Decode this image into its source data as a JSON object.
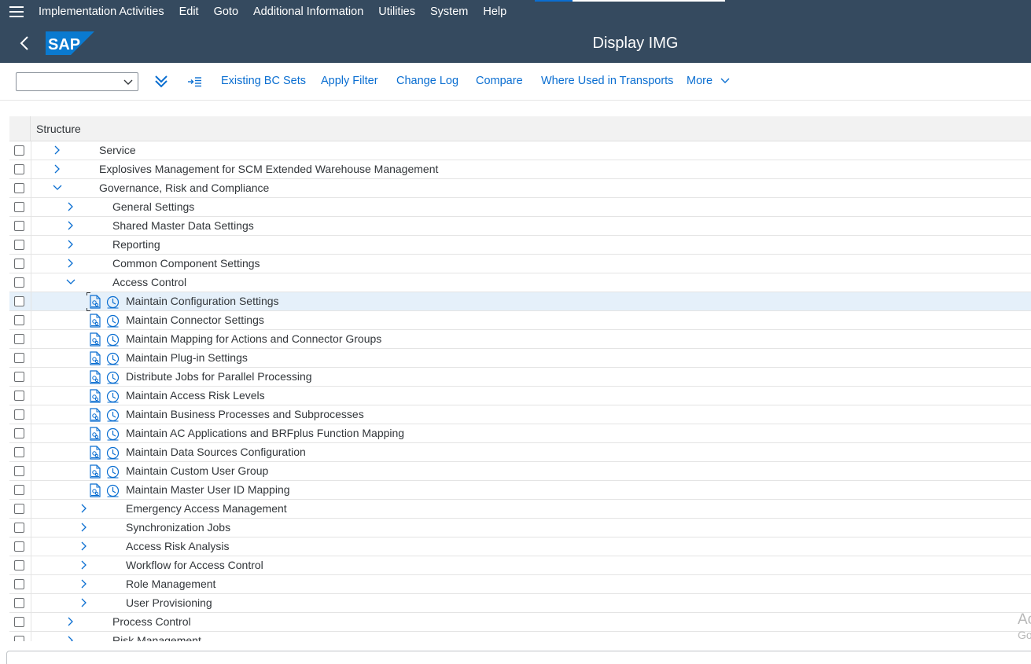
{
  "menubar": {
    "items": [
      "Implementation Activities",
      "Edit",
      "Goto",
      "Additional Information",
      "Utilities",
      "System",
      "Help"
    ]
  },
  "shell": {
    "title": "Display IMG",
    "logo_text": "SAP",
    "colors": {
      "shell_bg": "#354a5f",
      "logo_blue": "#0a7ad0"
    }
  },
  "toolbar": {
    "select_value": "",
    "buttons": {
      "existing_bc_sets": "Existing BC Sets",
      "apply_filter": "Apply Filter",
      "change_log": "Change Log",
      "compare": "Compare",
      "where_used": "Where Used in Transports",
      "more": "More"
    }
  },
  "table": {
    "header": "Structure",
    "rows": [
      {
        "label": "Service",
        "level": 1,
        "expander": "collapsed",
        "icons": false
      },
      {
        "label": "Explosives Management for SCM Extended Warehouse Management",
        "level": 1,
        "expander": "collapsed",
        "icons": false
      },
      {
        "label": "Governance, Risk and Compliance",
        "level": 1,
        "expander": "expanded",
        "icons": false
      },
      {
        "label": "General Settings",
        "level": 2,
        "expander": "collapsed",
        "icons": false
      },
      {
        "label": "Shared Master Data Settings",
        "level": 2,
        "expander": "collapsed",
        "icons": false
      },
      {
        "label": "Reporting",
        "level": 2,
        "expander": "collapsed",
        "icons": false
      },
      {
        "label": "Common Component Settings",
        "level": 2,
        "expander": "collapsed",
        "icons": false
      },
      {
        "label": "Access Control",
        "level": 2,
        "expander": "expanded",
        "icons": false
      },
      {
        "label": "Maintain Configuration Settings",
        "level": 3,
        "expander": "none",
        "icons": true,
        "selected": true
      },
      {
        "label": "Maintain Connector Settings",
        "level": 3,
        "expander": "none",
        "icons": true
      },
      {
        "label": "Maintain Mapping for Actions and Connector Groups",
        "level": 3,
        "expander": "none",
        "icons": true
      },
      {
        "label": "Maintain Plug-in Settings",
        "level": 3,
        "expander": "none",
        "icons": true
      },
      {
        "label": "Distribute Jobs for Parallel Processing",
        "level": 3,
        "expander": "none",
        "icons": true
      },
      {
        "label": "Maintain Access Risk Levels",
        "level": 3,
        "expander": "none",
        "icons": true
      },
      {
        "label": "Maintain Business Processes and Subprocesses",
        "level": 3,
        "expander": "none",
        "icons": true
      },
      {
        "label": "Maintain AC Applications and BRFplus Function Mapping",
        "level": 3,
        "expander": "none",
        "icons": true
      },
      {
        "label": "Maintain Data Sources Configuration",
        "level": 3,
        "expander": "none",
        "icons": true
      },
      {
        "label": "Maintain Custom User Group",
        "level": 3,
        "expander": "none",
        "icons": true
      },
      {
        "label": "Maintain Master User ID Mapping",
        "level": 3,
        "expander": "none",
        "icons": true
      },
      {
        "label": "Emergency Access Management",
        "level": 3,
        "expander": "collapsed",
        "icons": false
      },
      {
        "label": "Synchronization Jobs",
        "level": 3,
        "expander": "collapsed",
        "icons": false
      },
      {
        "label": "Access Risk Analysis",
        "level": 3,
        "expander": "collapsed",
        "icons": false
      },
      {
        "label": "Workflow for Access Control",
        "level": 3,
        "expander": "collapsed",
        "icons": false
      },
      {
        "label": "Role Management",
        "level": 3,
        "expander": "collapsed",
        "icons": false
      },
      {
        "label": "User Provisioning",
        "level": 3,
        "expander": "collapsed",
        "icons": false
      },
      {
        "label": "Process Control",
        "level": 2,
        "expander": "collapsed",
        "icons": false
      },
      {
        "label": "Risk Management",
        "level": 2,
        "expander": "collapsed",
        "icons": false
      }
    ]
  },
  "watermark": {
    "line1": "Ac",
    "line2": "Go"
  },
  "icons": {
    "menu": "hamburger-icon",
    "back": "back-arrow-icon",
    "expand_all": "double-chevron-down-icon",
    "indent": "indent-icon",
    "doc": "documentation-icon",
    "clock": "activity-clock-icon"
  },
  "accent_color": "#0a6ed1"
}
